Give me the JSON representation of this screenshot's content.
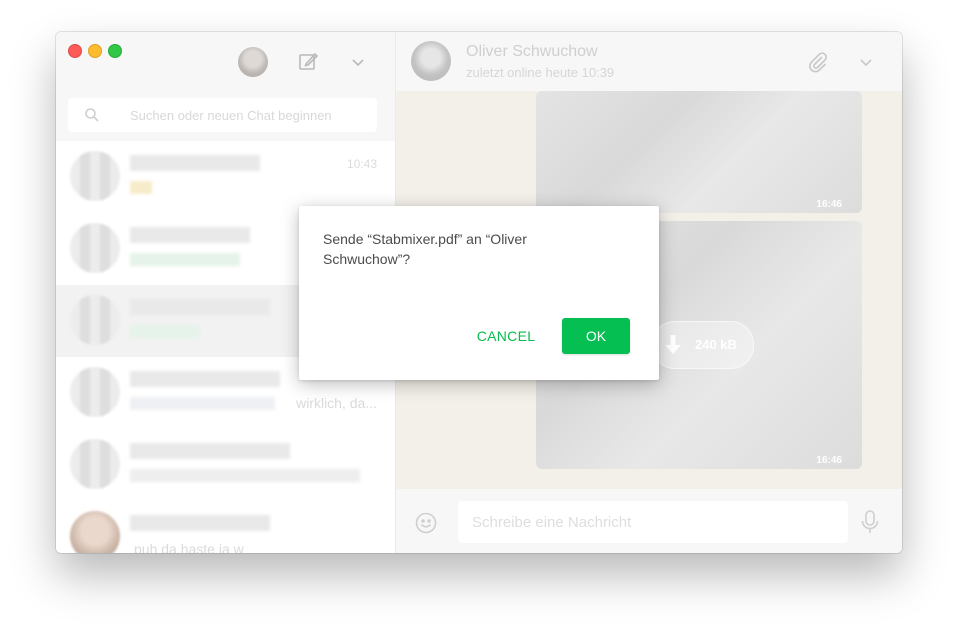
{
  "colors": {
    "accent": "#06bf53",
    "chat_background": "#f3efe9"
  },
  "left": {
    "search_placeholder": "Suchen oder neuen Chat beginnen",
    "chats": [
      {
        "time": "10:43"
      },
      {},
      {},
      {
        "snippet": "wirklich, da..."
      },
      {},
      {
        "snippet": "puh da haste ja w"
      }
    ]
  },
  "contact": {
    "name": "Oliver Schwuchow",
    "status": "zuletzt online heute 10:39"
  },
  "messages": [
    {
      "time": "16:46"
    },
    {
      "time": "16:46",
      "file_size": "240 kB"
    }
  ],
  "compose": {
    "placeholder": "Schreibe eine Nachricht"
  },
  "dialog": {
    "message": "Sende “Stabmixer.pdf” an “Oliver Schwuchow”?",
    "cancel_label": "CANCEL",
    "ok_label": "OK"
  }
}
